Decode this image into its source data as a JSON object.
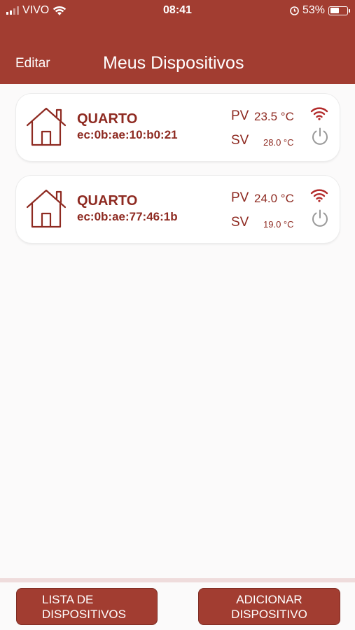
{
  "status_bar": {
    "carrier": "VIVO",
    "time": "08:41",
    "battery": "53%",
    "battery_level": 0.53
  },
  "header": {
    "edit_label": "Editar",
    "title": "Meus Dispositivos"
  },
  "devices": [
    {
      "name": "QUARTO",
      "mac": "ec:0b:ae:10:b0:21",
      "pv_label": "PV",
      "pv_value": "23.5 °C",
      "sv_label": "SV",
      "sv_value": "28.0 °C"
    },
    {
      "name": "QUARTO",
      "mac": "ec:0b:ae:77:46:1b",
      "pv_label": "PV",
      "pv_value": "24.0 °C",
      "sv_label": "SV",
      "sv_value": "19.0 °C"
    }
  ],
  "footer": {
    "list_line1": "LISTA DE",
    "list_line2": "DISPOSITIVOS",
    "add_line1": "ADICIONAR",
    "add_line2": "DISPOSITIVO"
  },
  "colors": {
    "brand": "#a23d31",
    "text_accent": "#8e2a21",
    "icon_gray": "#9a9a9a"
  },
  "icons": [
    "signal-icon",
    "wifi-icon",
    "alarm-icon",
    "battery-icon",
    "house-icon",
    "power-icon"
  ]
}
